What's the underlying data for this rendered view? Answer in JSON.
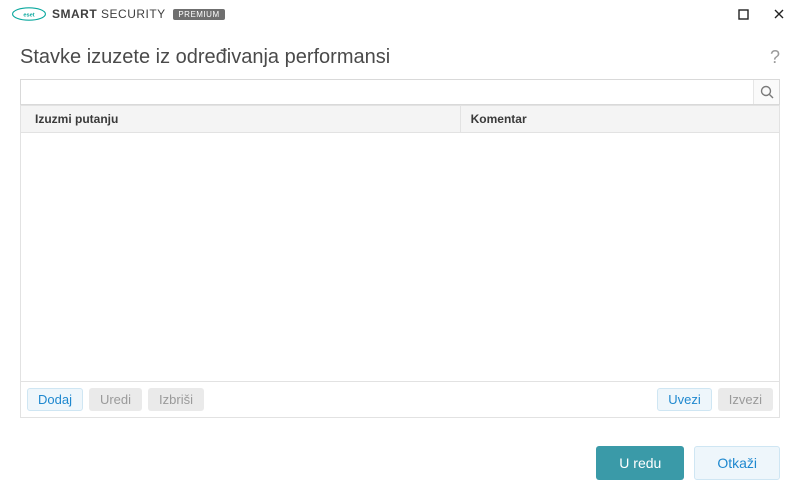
{
  "titlebar": {
    "brand_main": "SMART",
    "brand_sub": "SECURITY",
    "badge": "PREMIUM"
  },
  "header": {
    "title": "Stavke izuzete iz određivanja performansi",
    "help": "?"
  },
  "search": {
    "placeholder": ""
  },
  "table": {
    "col_path": "Izuzmi putanju",
    "col_comment": "Komentar",
    "rows": []
  },
  "actions": {
    "add": "Dodaj",
    "edit": "Uredi",
    "delete": "Izbriši",
    "import": "Uvezi",
    "export": "Izvezi"
  },
  "footer": {
    "ok": "U redu",
    "cancel": "Otkaži"
  }
}
